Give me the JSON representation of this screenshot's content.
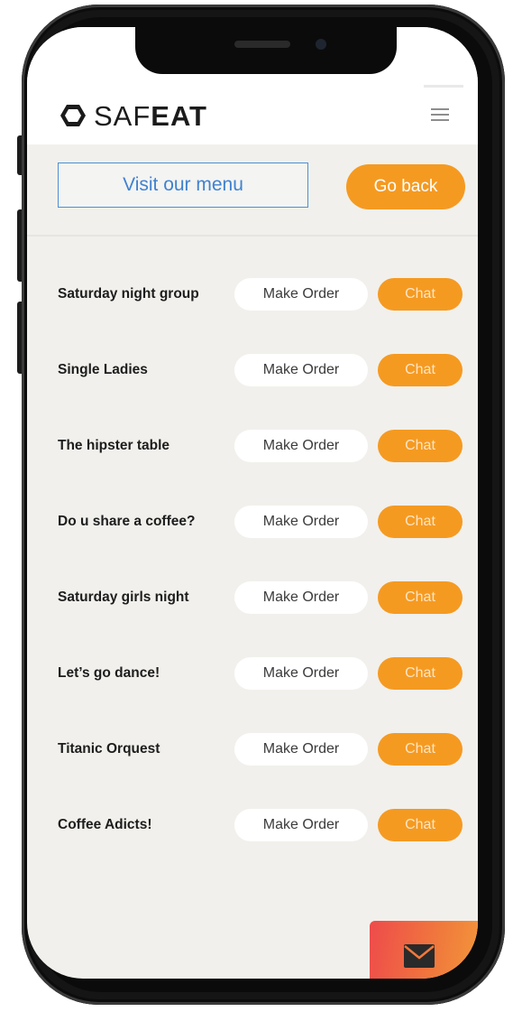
{
  "brand": {
    "logo_light": "SAF",
    "logo_bold": "EAT",
    "accent": "#f59a21",
    "link": "#3f82d0"
  },
  "header": {
    "menu_icon": "hamburger-icon"
  },
  "actions": {
    "visit_label": "Visit our menu",
    "back_label": "Go back"
  },
  "groups": [
    {
      "name": "Saturday night group",
      "order_label": "Make Order",
      "chat_label": "Chat"
    },
    {
      "name": "Single Ladies",
      "order_label": "Make Order",
      "chat_label": "Chat"
    },
    {
      "name": "The hipster table",
      "order_label": "Make Order",
      "chat_label": "Chat"
    },
    {
      "name": "Do u share a coffee?",
      "order_label": "Make Order",
      "chat_label": "Chat"
    },
    {
      "name": "Saturday girls night",
      "order_label": "Make Order",
      "chat_label": "Chat"
    },
    {
      "name": "Let’s go dance!",
      "order_label": "Make Order",
      "chat_label": "Chat"
    },
    {
      "name": "Titanic Orquest",
      "order_label": "Make Order",
      "chat_label": "Chat"
    },
    {
      "name": "Coffee Adicts!",
      "order_label": "Make Order",
      "chat_label": "Chat"
    }
  ],
  "fab": {
    "icon": "mail-icon"
  }
}
